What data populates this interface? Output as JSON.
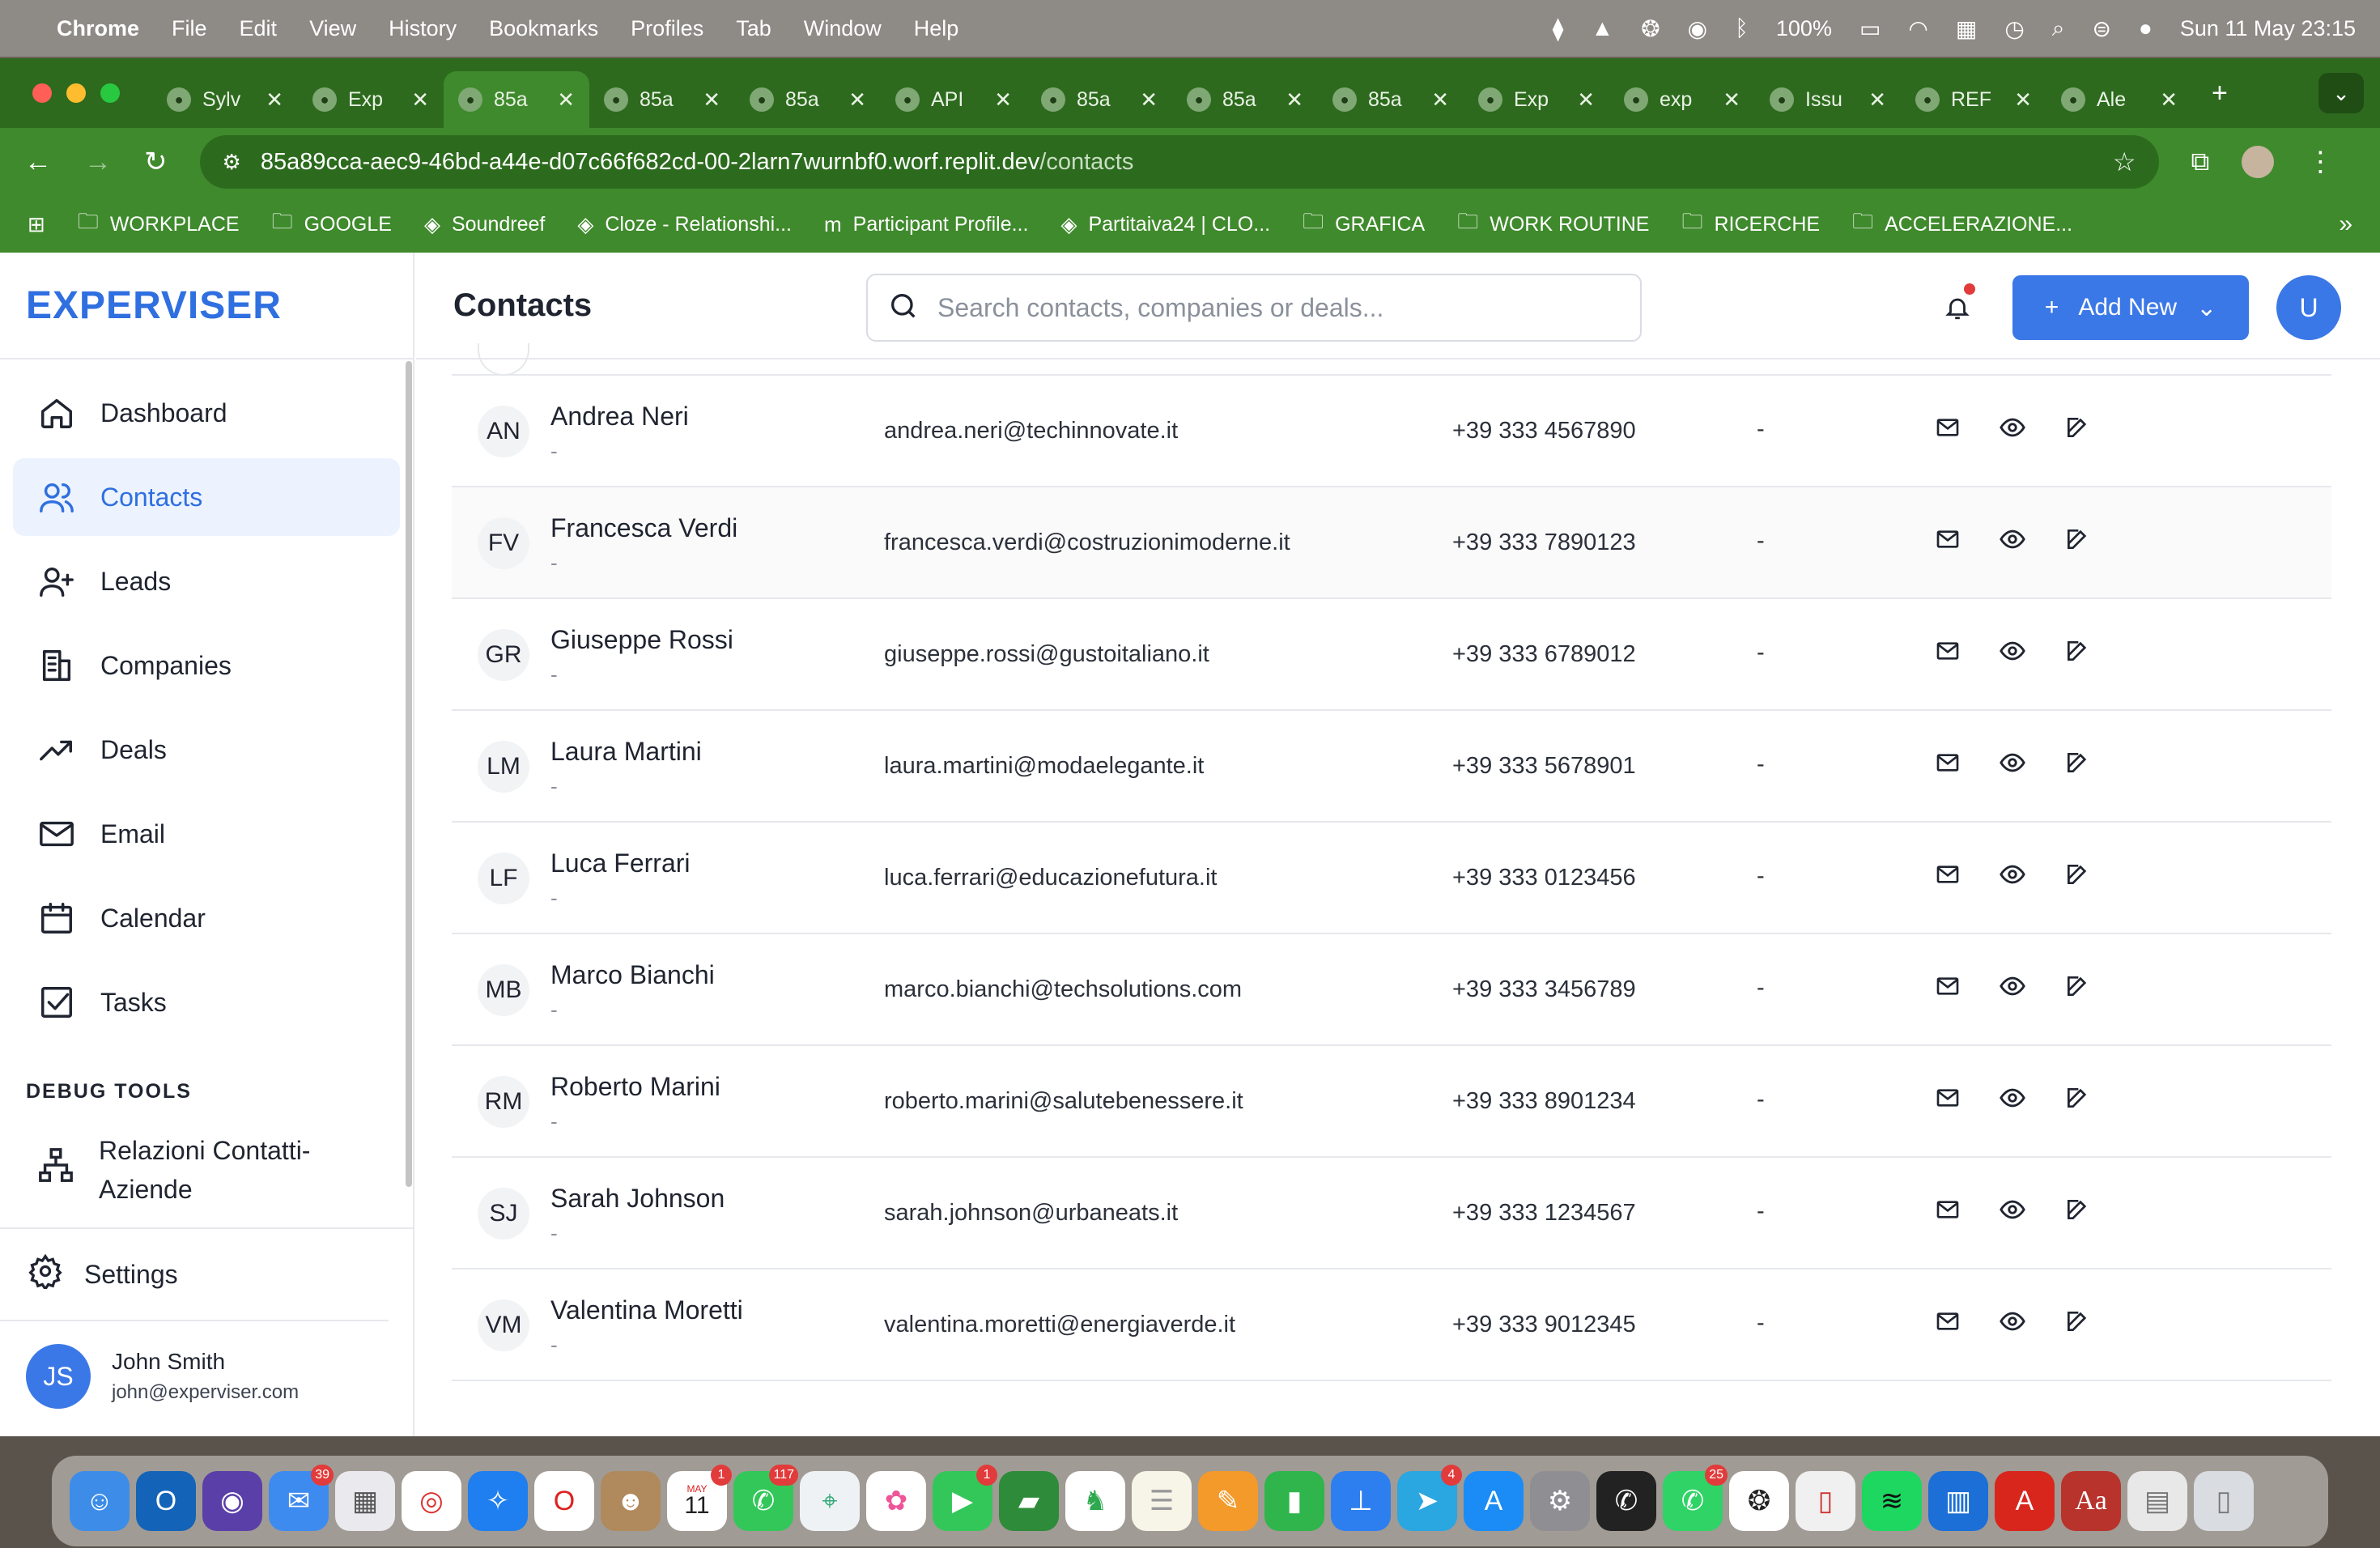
{
  "menubar": {
    "app": "Chrome",
    "items": [
      "File",
      "Edit",
      "View",
      "History",
      "Bookmarks",
      "Profiles",
      "Tab",
      "Window",
      "Help"
    ],
    "battery": "100%",
    "clock": "Sun 11 May  23:15"
  },
  "browser": {
    "tabs": [
      {
        "label": "Sylv",
        "icon": "p-icon"
      },
      {
        "label": "Exp",
        "icon": "grid-icon"
      },
      {
        "label": "85a",
        "icon": "globe-icon",
        "active": true
      },
      {
        "label": "85a",
        "icon": "globe-icon"
      },
      {
        "label": "85a",
        "icon": "globe-icon"
      },
      {
        "label": "API",
        "icon": "globe-icon"
      },
      {
        "label": "85a",
        "icon": "globe-icon"
      },
      {
        "label": "85a",
        "icon": "globe-icon"
      },
      {
        "label": "85a",
        "icon": "globe-icon"
      },
      {
        "label": "Exp",
        "icon": "github-icon"
      },
      {
        "label": "exp",
        "icon": "globe-icon"
      },
      {
        "label": "Issu",
        "icon": "github-icon"
      },
      {
        "label": "REF",
        "icon": "google-icon"
      },
      {
        "label": "Ale",
        "icon": "x-icon"
      }
    ],
    "url_host": "85a89cca-aec9-46bd-a44e-d07c66f682cd-00-2larn7wurnbf0.worf.replit.dev",
    "url_path": "/contacts",
    "bookmarks": [
      {
        "label": "WORKPLACE",
        "icon": "folder-icon"
      },
      {
        "label": "GOOGLE",
        "icon": "folder-icon"
      },
      {
        "label": "Soundreef",
        "icon": "soundreef-icon"
      },
      {
        "label": "Cloze - Relationshi...",
        "icon": "cloze-icon"
      },
      {
        "label": "Participant Profile...",
        "icon": "m-icon"
      },
      {
        "label": "Partitaiva24 | CLO...",
        "icon": "globe-icon"
      },
      {
        "label": "GRAFICA",
        "icon": "folder-icon"
      },
      {
        "label": "WORK ROUTINE",
        "icon": "folder-icon"
      },
      {
        "label": "RICERCHE",
        "icon": "folder-icon"
      },
      {
        "label": "ACCELERAZIONE...",
        "icon": "folder-icon"
      }
    ]
  },
  "sidebar": {
    "brand": "EXPERVISER",
    "items": [
      {
        "label": "Dashboard",
        "icon": "home-icon"
      },
      {
        "label": "Contacts",
        "icon": "users-icon",
        "active": true
      },
      {
        "label": "Leads",
        "icon": "user-plus-icon"
      },
      {
        "label": "Companies",
        "icon": "building-icon"
      },
      {
        "label": "Deals",
        "icon": "trending-up-icon"
      },
      {
        "label": "Email",
        "icon": "mail-icon"
      },
      {
        "label": "Calendar",
        "icon": "calendar-icon"
      },
      {
        "label": "Tasks",
        "icon": "check-square-icon"
      }
    ],
    "debug_title": "DEBUG TOOLS",
    "debug_item": "Relazioni Contatti-Aziende",
    "settings": "Settings",
    "user": {
      "initials": "JS",
      "name": "John Smith",
      "email": "john@experviser.com"
    }
  },
  "header": {
    "title": "Contacts",
    "search_placeholder": "Search contacts, companies or deals...",
    "add_new": "Add New",
    "user_initial": "U"
  },
  "contacts": [
    {
      "initials": "AN",
      "name": "Andrea Neri",
      "sub": "-",
      "email": "andrea.neri@techinnovate.it",
      "phone": "+39 333 4567890",
      "company": "-"
    },
    {
      "initials": "FV",
      "name": "Francesca Verdi",
      "sub": "-",
      "email": "francesca.verdi@costruzionimoderne.it",
      "phone": "+39 333 7890123",
      "company": "-"
    },
    {
      "initials": "GR",
      "name": "Giuseppe Rossi",
      "sub": "-",
      "email": "giuseppe.rossi@gustoitaliano.it",
      "phone": "+39 333 6789012",
      "company": "-"
    },
    {
      "initials": "LM",
      "name": "Laura Martini",
      "sub": "-",
      "email": "laura.martini@modaelegante.it",
      "phone": "+39 333 5678901",
      "company": "-"
    },
    {
      "initials": "LF",
      "name": "Luca Ferrari",
      "sub": "-",
      "email": "luca.ferrari@educazionefutura.it",
      "phone": "+39 333 0123456",
      "company": "-"
    },
    {
      "initials": "MB",
      "name": "Marco Bianchi",
      "sub": "-",
      "email": "marco.bianchi@techsolutions.com",
      "phone": "+39 333 3456789",
      "company": "-"
    },
    {
      "initials": "RM",
      "name": "Roberto Marini",
      "sub": "-",
      "email": "roberto.marini@salutebenessere.it",
      "phone": "+39 333 8901234",
      "company": "-"
    },
    {
      "initials": "SJ",
      "name": "Sarah Johnson",
      "sub": "-",
      "email": "sarah.johnson@urbaneats.it",
      "phone": "+39 333 1234567",
      "company": "-"
    },
    {
      "initials": "VM",
      "name": "Valentina Moretti",
      "sub": "-",
      "email": "valentina.moretti@energiaverde.it",
      "phone": "+39 333 9012345",
      "company": "-"
    }
  ],
  "dock": {
    "badges": {
      "mail": "39",
      "calendar_day": "11",
      "calendar_month": "MAY",
      "calendar_badge": "1",
      "messages": "117",
      "facetime": "1",
      "telegram": "4",
      "whatsapp": "25"
    }
  },
  "colors": {
    "accent": "#3b78e7",
    "brand": "#2f6fe0",
    "chrome_green": "#3f8a2c"
  }
}
